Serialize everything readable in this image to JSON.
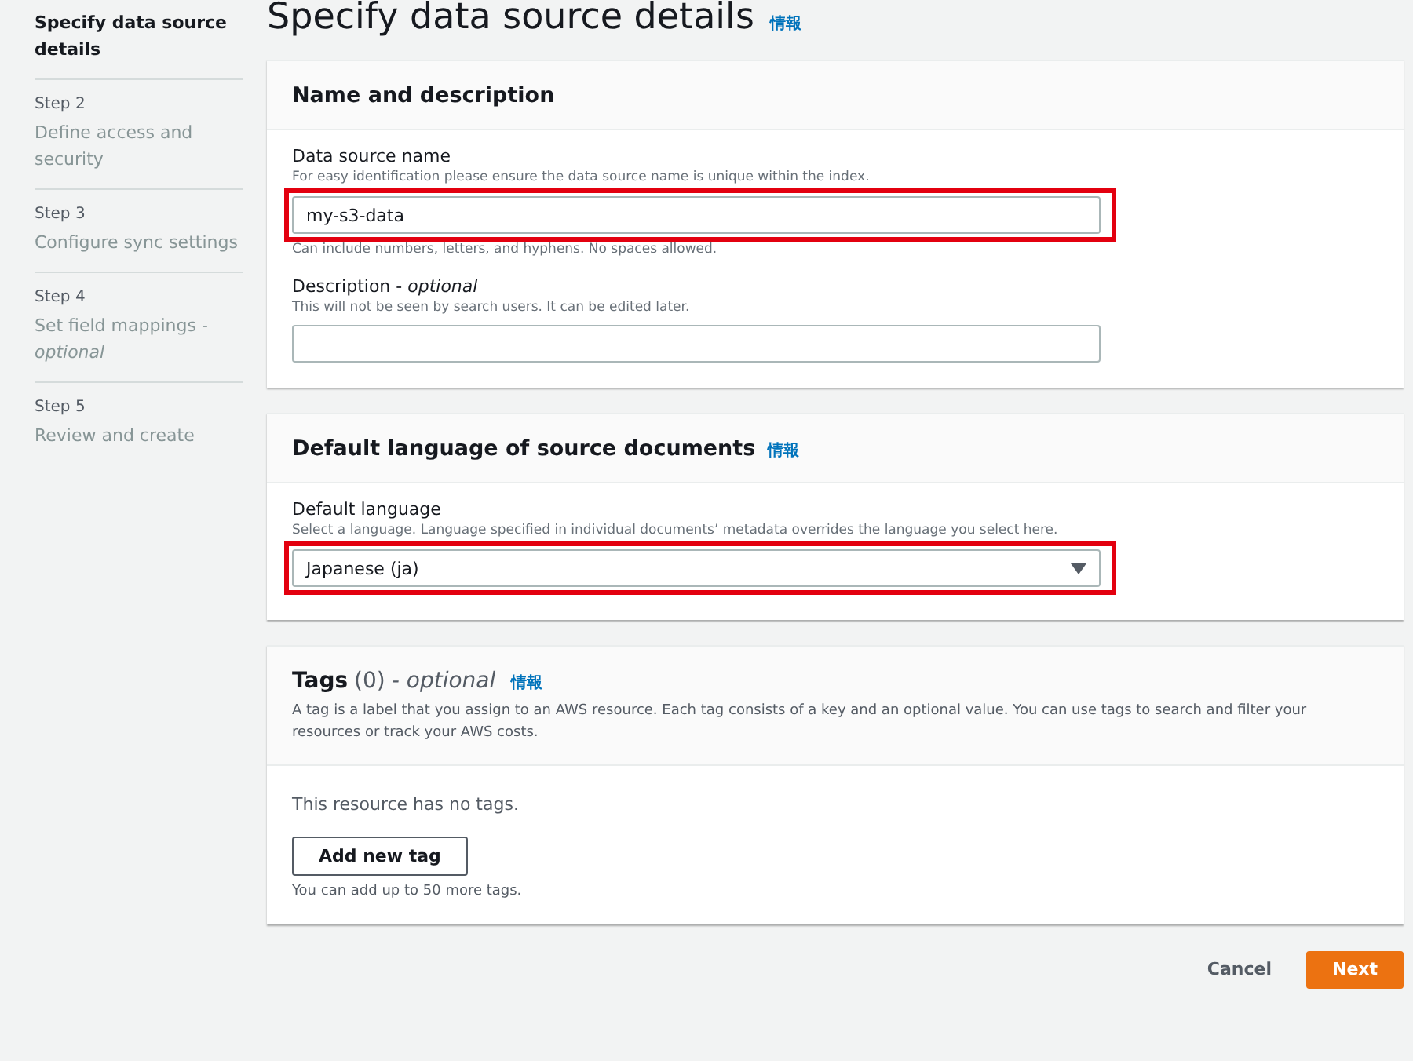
{
  "steps": [
    {
      "title": "Specify data source details",
      "selected": true
    },
    {
      "label": "Step 2",
      "title": "Define access and security",
      "selected": false
    },
    {
      "label": "Step 3",
      "title": "Configure sync settings",
      "selected": false
    },
    {
      "label": "Step 4",
      "title": "Set field mappings - *optional*",
      "selected": false
    },
    {
      "label": "Step 5",
      "title": "Review and create",
      "selected": false
    }
  ],
  "page": {
    "title": "Specify data source details",
    "info_link": "情報"
  },
  "cards": [
    {
      "kind": "fields",
      "title": "Name and description",
      "fields": [
        {
          "kind": "text",
          "label": "Data source name",
          "hint": "For easy identification please ensure the data source name is unique within the index.",
          "value": "my-s3-data",
          "note": "Can include numbers, letters, and hyphens. No spaces allowed.",
          "highlighted": true
        },
        {
          "kind": "textarea",
          "label": "Description - *optional*",
          "hint": "This will not be seen by search users. It can be edited later.",
          "highlighted": false
        }
      ]
    },
    {
      "kind": "fields",
      "title": "Default language of source documents",
      "info_link": "情報",
      "fields": [
        {
          "kind": "select",
          "label": "Default language",
          "hint": "Select a language. Language specified in individual documents’ metadata overrides the language you select here.",
          "value": "Japanese (ja)",
          "highlighted": true
        }
      ]
    },
    {
      "kind": "tags",
      "title": "Tags",
      "count": "(0)",
      "optional": "- optional",
      "info_link": "情報",
      "description": "A tag is a label that you assign to an AWS resource. Each tag consists of a key and an optional value. You can use tags to search and filter your resources or track your AWS costs.",
      "empty_text": "This resource has no tags.",
      "add_button": "Add new tag",
      "limit_note": "You can add up to 50 more tags."
    }
  ],
  "footer": {
    "cancel": "Cancel",
    "next": "Next"
  }
}
